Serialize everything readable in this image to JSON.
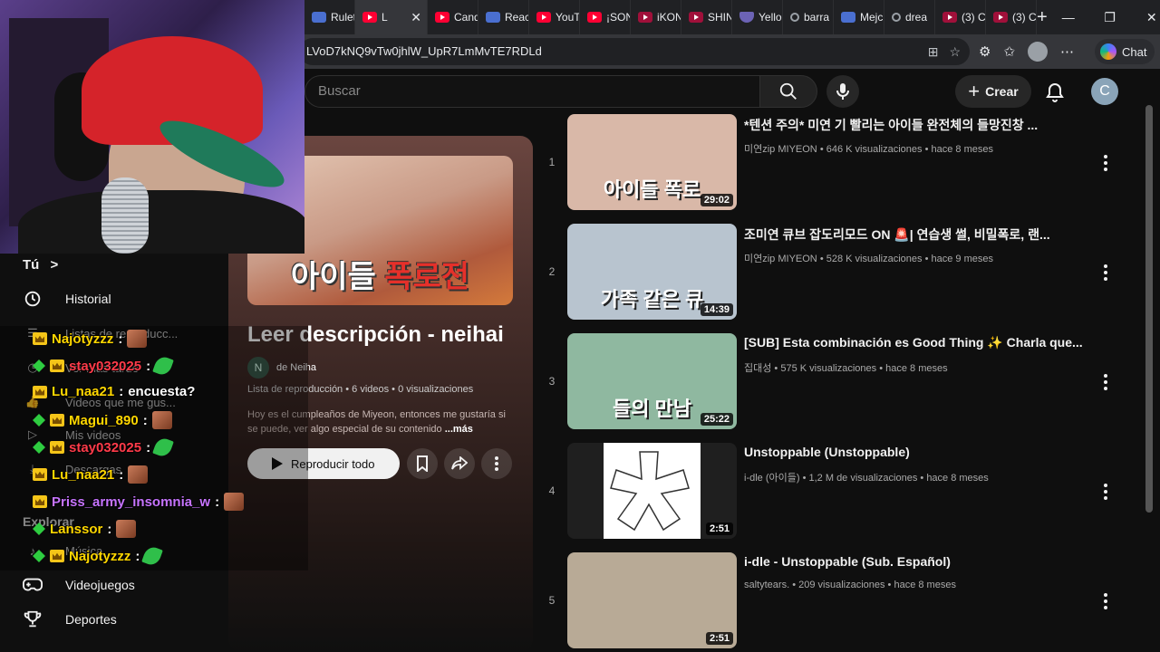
{
  "browser": {
    "tabs": [
      {
        "label": "Rulet",
        "icon": "blue"
      },
      {
        "label": "L",
        "icon": "yt",
        "active": true
      },
      {
        "label": "Cand",
        "icon": "yt"
      },
      {
        "label": "Reac",
        "icon": "blue"
      },
      {
        "label": "YouT",
        "icon": "yt"
      },
      {
        "label": "¡SON",
        "icon": "yt"
      },
      {
        "label": "iKON",
        "icon": "dark"
      },
      {
        "label": "SHIN",
        "icon": "dark"
      },
      {
        "label": "Yello",
        "icon": "shield"
      },
      {
        "label": "barra",
        "icon": "srch"
      },
      {
        "label": "Mejc",
        "icon": "blue"
      },
      {
        "label": "drea",
        "icon": "srch"
      },
      {
        "label": "(3) C",
        "icon": "dark"
      },
      {
        "label": "(3) C",
        "icon": "dark"
      }
    ],
    "new_tab": "+",
    "url": "LVoD7kNQ9vTw0jhlW_UpR7LmMvTE7RDLd",
    "chat_label": "Chat",
    "window_controls": [
      "—",
      "❐",
      "✕"
    ]
  },
  "header": {
    "search_placeholder": "Buscar",
    "create_label": "Crear",
    "avatar_letter": "C"
  },
  "sidebar": {
    "you_label": "Tú",
    "you_chevron": ">",
    "items": [
      {
        "label": "Historial",
        "icon": "history-icon"
      },
      {
        "label": "Listas de reproducc...",
        "icon": "playlist-icon"
      },
      {
        "label": "Ver más tarde",
        "icon": "clock-icon"
      },
      {
        "label": "Videos que me gus...",
        "icon": "thumb-up-icon"
      },
      {
        "label": "Mis videos",
        "icon": "my-videos-icon"
      },
      {
        "label": "Descargas",
        "icon": "download-icon"
      }
    ],
    "explore_label": "Explorar",
    "explore_items": [
      {
        "label": "Música",
        "icon": "music-icon"
      },
      {
        "label": "Videojuegos",
        "icon": "gaming-icon"
      },
      {
        "label": "Deportes",
        "icon": "trophy-icon"
      }
    ]
  },
  "playlist": {
    "thumb_text_white": "아이들",
    "thumb_text_red": "폭로전",
    "title": "Leer descripción - neihai",
    "owner_initial": "N",
    "owner": "de Neiha",
    "meta": "Lista de reproducción • 6 videos • 0 visualizaciones",
    "description": "Hoy es el cumpleaños de Miyeon, entonces me gustaría si se puede, ver algo especial de su contenido",
    "more": "...más",
    "play_all": "Reproducir todo"
  },
  "videos": [
    {
      "index": "1",
      "title": "*텐션 주의* 미연 기 빨리는 아이들 완전체의 들망진창 ...",
      "channel": "미연zip MIYEON",
      "views": "646 K visualizaciones",
      "age": "hace 8 meses",
      "duration": "29:02",
      "caption": "아이들 폭로",
      "bg": "#d9b8a8"
    },
    {
      "index": "2",
      "title": "조미연 큐브 잡도리모드 ON 🚨| 연습생 썰, 비밀폭로, 랜...",
      "channel": "미연zip MIYEON",
      "views": "528 K visualizaciones",
      "age": "hace 9 meses",
      "duration": "14:39",
      "caption": "가족 같은 큐",
      "bg": "#b8c4cf"
    },
    {
      "index": "3",
      "title": "[SUB] Esta combinación es Good Thing ✨ Charla que...",
      "channel": "집대성",
      "views": "575 K visualizaciones",
      "age": "hace 8 meses",
      "duration": "25:22",
      "caption": "들의 만남",
      "bg": "#8fb8a0"
    },
    {
      "index": "4",
      "title": "Unstoppable (Unstoppable)",
      "channel": "i-dle (아이들)",
      "views": "1,2 M de visualizaciones",
      "age": "hace 8 meses",
      "duration": "2:51",
      "caption": "",
      "bg": "#ffffff"
    },
    {
      "index": "5",
      "title": "i-dle - Unstoppable (Sub. Español)",
      "channel": "saltytears.",
      "views": "209 visualizaciones",
      "age": "hace 8 meses",
      "duration": "2:51",
      "caption": "",
      "bg": "#b8aa96"
    }
  ],
  "chat": [
    {
      "badges": [
        "sub"
      ],
      "user": "Najotyzzz",
      "color": "yellow",
      "text": "",
      "emote": "face"
    },
    {
      "badges": [
        "mod",
        "sub"
      ],
      "user": "stay032025",
      "color": "red",
      "text": "",
      "emote": "leaf"
    },
    {
      "badges": [
        "sub"
      ],
      "user": "Lu_naa21",
      "color": "yellow",
      "text": "encuesta?",
      "emote": ""
    },
    {
      "badges": [
        "mod",
        "sub"
      ],
      "user": "Magui_890",
      "color": "yellow",
      "text": "",
      "emote": "face"
    },
    {
      "badges": [
        "mod",
        "sub"
      ],
      "user": "stay032025",
      "color": "red",
      "text": "",
      "emote": "leaf"
    },
    {
      "badges": [
        "sub"
      ],
      "user": "Lu_naa21",
      "color": "yellow",
      "text": "",
      "emote": "face"
    },
    {
      "badges": [
        "sub"
      ],
      "user": "Priss_army_insomnia_w",
      "color": "purple",
      "text": "",
      "emote": "face"
    },
    {
      "badges": [
        "mod"
      ],
      "user": "Lanssor",
      "color": "yellow",
      "text": "",
      "emote": "face"
    },
    {
      "badges": [
        "mod",
        "sub"
      ],
      "user": "Najotyzzz",
      "color": "yellow",
      "text": "",
      "emote": "leaf"
    }
  ]
}
